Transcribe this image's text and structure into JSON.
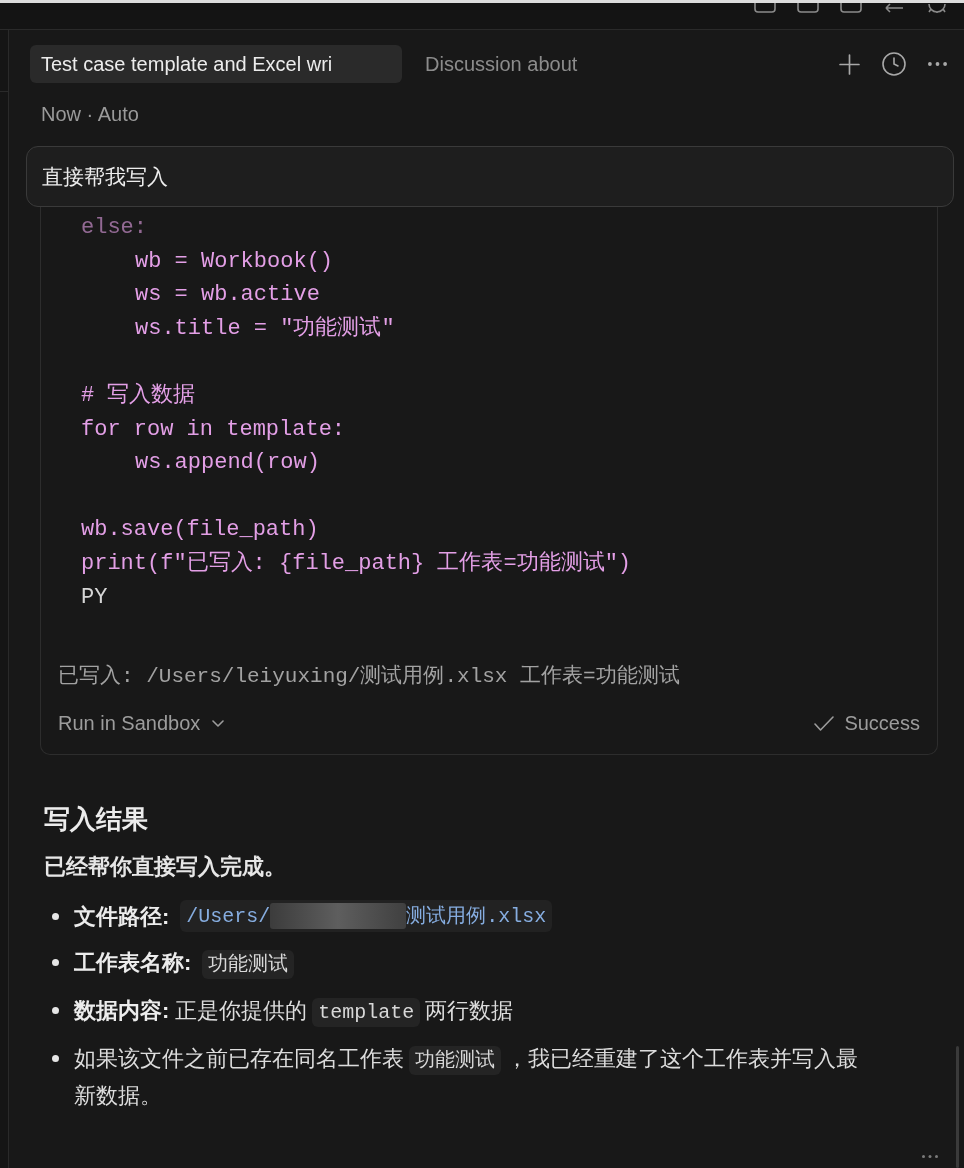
{
  "tabs": [
    {
      "label": "Test case template and Excel wri",
      "selected": true
    },
    {
      "label": "Discussion about",
      "selected": false
    }
  ],
  "meta": "Now · Auto",
  "user_message": {
    "text": "直接帮我写入"
  },
  "code_block": {
    "blocks": [
      [
        {
          "text": "else:",
          "kind": "string",
          "faded": true,
          "children": [
            {
              "text": "wb = Workbook()",
              "kind": "string",
              "faded": false
            },
            {
              "text": "ws = wb.active",
              "kind": "string",
              "faded": false
            },
            {
              "text": "ws.title = \"功能测试\"",
              "kind": "string",
              "faded": false
            }
          ]
        }
      ],
      [
        {
          "text": "# 写入数据",
          "kind": "string",
          "faded": false
        },
        {
          "text": "for row in template:",
          "kind": "string",
          "faded": false,
          "children": [
            {
              "text": "ws.append(row)",
              "kind": "string",
              "faded": false
            }
          ]
        }
      ],
      [
        {
          "text": "wb.save(file_path)",
          "kind": "string",
          "faded": false
        },
        {
          "text": "print(f\"已写入: {file_path} 工作表=功能测试\")",
          "kind": "string",
          "faded": false
        },
        {
          "text": "PY",
          "kind": "plain",
          "faded": false
        }
      ]
    ],
    "output": "已写入: /Users/leiyuxing/测试用例.xlsx 工作表=功能测试",
    "runner": {
      "label": "Run in Sandbox"
    },
    "status": {
      "kind": "success",
      "label": "Success"
    }
  },
  "result": {
    "heading": "写入结果",
    "summary": "已经帮你直接写入完成。",
    "items": [
      {
        "parts": [
          {
            "kind": "label",
            "text": "文件路径:"
          },
          {
            "kind": "path",
            "start": "/Users/",
            "end": "测试用例.xlsx",
            "redacted": true
          }
        ]
      },
      {
        "parts": [
          {
            "kind": "label",
            "text": "工作表名称:"
          },
          {
            "kind": "code",
            "text": "功能测试"
          }
        ]
      },
      {
        "parts": [
          {
            "kind": "label",
            "text": "数据内容:"
          },
          {
            "kind": "text",
            "text": "正是你提供的"
          },
          {
            "kind": "code",
            "text": "template"
          },
          {
            "kind": "text",
            "text": "两行数据"
          }
        ]
      },
      {
        "parts": [
          {
            "kind": "text",
            "text": "如果该文件之前已存在同名工作表"
          },
          {
            "kind": "code",
            "text": "功能测试"
          },
          {
            "kind": "text",
            "text": "，我已经重建了这个工作表并写入最"
          },
          {
            "kind": "text",
            "text": "新数据。"
          }
        ]
      }
    ]
  }
}
